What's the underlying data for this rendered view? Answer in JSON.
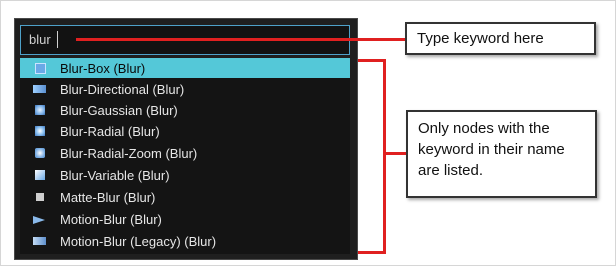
{
  "search": {
    "value": "blur"
  },
  "results": [
    {
      "label": "Blur-Box (Blur)",
      "icon": "blur-box-icon",
      "selected": true
    },
    {
      "label": "Blur-Directional (Blur)",
      "icon": "blur-directional-icon",
      "selected": false
    },
    {
      "label": "Blur-Gaussian (Blur)",
      "icon": "blur-gaussian-icon",
      "selected": false
    },
    {
      "label": "Blur-Radial (Blur)",
      "icon": "blur-radial-icon",
      "selected": false
    },
    {
      "label": "Blur-Radial-Zoom (Blur)",
      "icon": "blur-radial-zoom-icon",
      "selected": false
    },
    {
      "label": "Blur-Variable (Blur)",
      "icon": "blur-variable-icon",
      "selected": false
    },
    {
      "label": "Matte-Blur (Blur)",
      "icon": "matte-blur-icon",
      "selected": false
    },
    {
      "label": "Motion-Blur (Blur)",
      "icon": "motion-blur-icon",
      "selected": false
    },
    {
      "label": "Motion-Blur (Legacy) (Blur)",
      "icon": "motion-blur-legacy-icon",
      "selected": false
    }
  ],
  "callouts": {
    "search_hint": "Type keyword here",
    "list_hint": "Only nodes with the keyword in their name are listed."
  },
  "colors": {
    "selection": "#54c8d8",
    "callout_line": "#e02020",
    "search_border": "#4ea1c9"
  }
}
